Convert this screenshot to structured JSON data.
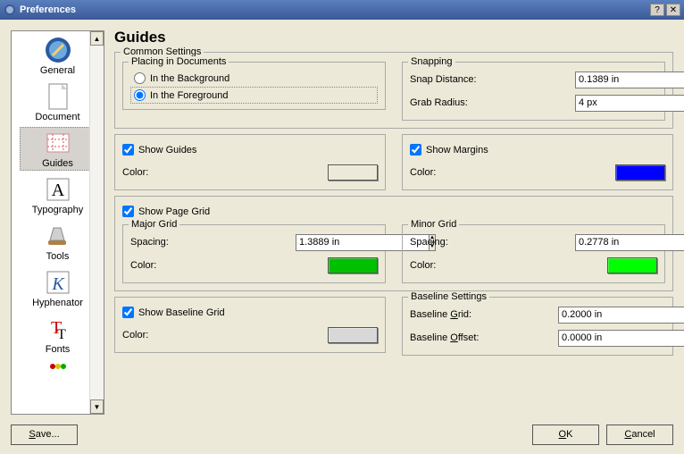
{
  "window": {
    "title": "Preferences"
  },
  "sidebar": {
    "items": [
      {
        "label": "General"
      },
      {
        "label": "Document"
      },
      {
        "label": "Guides"
      },
      {
        "label": "Typography"
      },
      {
        "label": "Tools"
      },
      {
        "label": "Hyphenator"
      },
      {
        "label": "Fonts"
      }
    ]
  },
  "page": {
    "title": "Guides",
    "common": {
      "legend": "Common Settings",
      "placing": {
        "legend": "Placing in Documents",
        "background": "In the Background",
        "foreground": "In the Foreground",
        "selected": "foreground"
      },
      "snapping": {
        "legend": "Snapping",
        "snap_distance_label": "Snap Distance:",
        "snap_distance_value": "0.1389 in",
        "grab_radius_label": "Grab Radius:",
        "grab_radius_value": "4 px"
      }
    },
    "guides": {
      "check_label": "Show Guides",
      "checked": true,
      "color_label": "Color:",
      "color": "#000080"
    },
    "margins": {
      "check_label": "Show Margins",
      "checked": true,
      "color_label": "Color:",
      "color": "#0000ff"
    },
    "pagegrid": {
      "check_label": "Show Page Grid",
      "checked": true,
      "major": {
        "legend": "Major Grid",
        "spacing_label": "Spacing:",
        "spacing_value": "1.3889 in",
        "color_label": "Color:",
        "color": "#00c000"
      },
      "minor": {
        "legend": "Minor Grid",
        "spacing_label": "Spacing:",
        "spacing_value": "0.2778 in",
        "color_label": "Color:",
        "color": "#00ff00"
      }
    },
    "baseline": {
      "check_label": "Show Baseline Grid",
      "checked": true,
      "color_label": "Color:",
      "color": "#d8d8d8",
      "settings": {
        "legend": "Baseline Settings",
        "grid_label": "Baseline Grid:",
        "grid_value": "0.2000 in",
        "offset_label": "Baseline Offset:",
        "offset_value": "0.0000 in"
      }
    }
  },
  "buttons": {
    "save": "Save...",
    "ok": "OK",
    "cancel": "Cancel"
  }
}
